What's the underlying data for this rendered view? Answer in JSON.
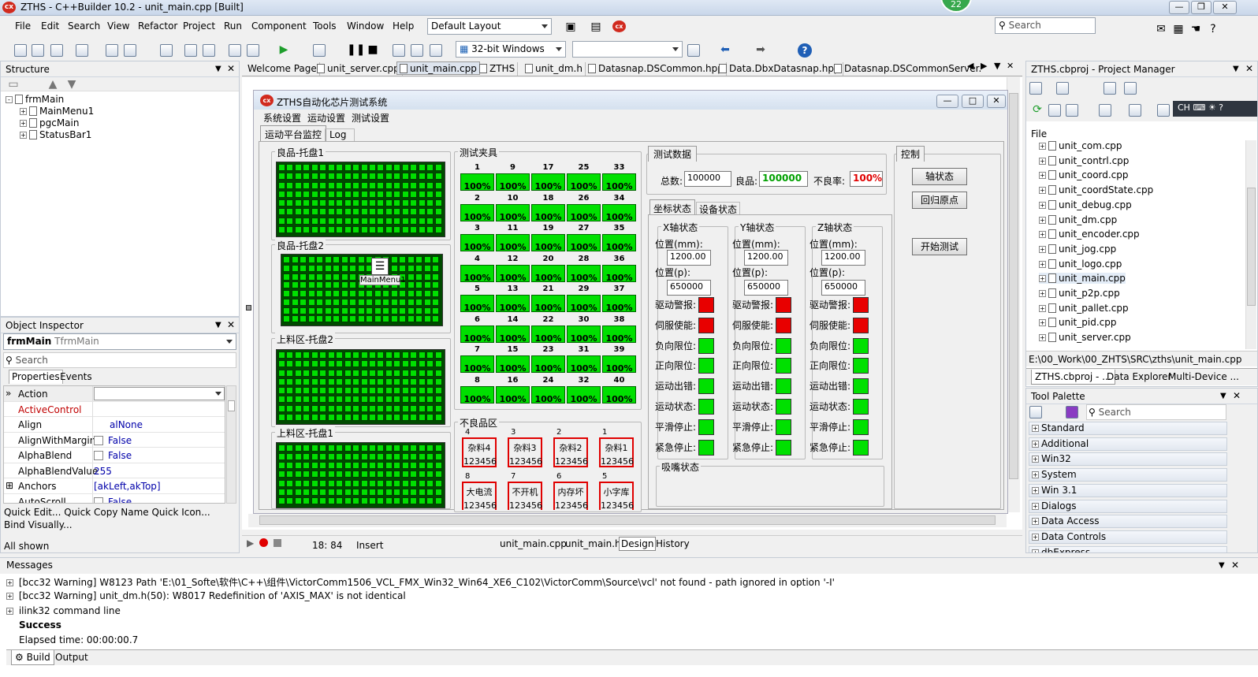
{
  "window": {
    "title": "ZTHS - C++Builder 10.2 - unit_main.cpp [Built]",
    "badge": "22",
    "app_icon": "cx"
  },
  "menu": [
    "File",
    "Edit",
    "Search",
    "View",
    "Refactor",
    "Project",
    "Run",
    "Component",
    "Tools",
    "Window",
    "Help"
  ],
  "layout_combo": "Default Layout",
  "top_search": {
    "placeholder": "Search"
  },
  "platform_combo": "32-bit Windows",
  "structure": {
    "title": "Structure",
    "root": "frmMain",
    "children": [
      "MainMenu1",
      "pgcMain",
      "StatusBar1"
    ]
  },
  "object_inspector": {
    "title": "Object Inspector",
    "object": "frmMain",
    "class": "TfrmMain",
    "search": "Search",
    "tabs": [
      "Properties",
      "Events"
    ],
    "rows": [
      {
        "name": "Action",
        "value": ""
      },
      {
        "name": "ActiveControl",
        "value": ""
      },
      {
        "name": "Align",
        "value": "alNone"
      },
      {
        "name": "AlignWithMargins",
        "value": "False"
      },
      {
        "name": "AlphaBlend",
        "value": "False"
      },
      {
        "name": "AlphaBlendValue",
        "value": "255"
      },
      {
        "name": "Anchors",
        "value": "[akLeft,akTop]"
      },
      {
        "name": "AutoScroll",
        "value": "False"
      }
    ],
    "quick_line1": "Quick Edit...  Quick Copy Name  Quick Icon...",
    "quick_line2": "Bind Visually...",
    "status": "All shown"
  },
  "editor_tabs": [
    "Welcome Page",
    "unit_server.cpp",
    "unit_main.cpp",
    "ZTHS",
    "unit_dm.h",
    "Datasnap.DSCommon.hpp",
    "Data.DbxDatasnap.hpp",
    "Datasnap.DSCommonServer."
  ],
  "designer": {
    "form_title": "ZTHS自动化芯片测试系统",
    "form_icon": "cx",
    "menus": [
      "系统设置",
      "运动设置",
      "测试设置"
    ],
    "tabs": [
      "运动平台监控",
      "Log"
    ],
    "trays": [
      "良品-托盘1",
      "良品-托盘2",
      "上料区-托盘2",
      "上料区-托盘1"
    ],
    "component_label": "MainMenu1",
    "fixture_title": "测试夹具",
    "fixture_pct": "100%",
    "fixture_cols": [
      [
        1,
        2,
        3,
        4,
        5,
        6,
        7,
        8
      ],
      [
        9,
        10,
        11,
        12,
        13,
        14,
        15,
        16
      ],
      [
        17,
        18,
        19,
        20,
        21,
        22,
        23,
        24
      ],
      [
        25,
        26,
        27,
        28,
        29,
        30,
        31,
        32
      ],
      [
        33,
        34,
        35,
        36,
        37,
        38,
        39,
        40
      ]
    ],
    "reject_title": "不良品区",
    "rejects_top": [
      {
        "n": "4",
        "l": "杂料4"
      },
      {
        "n": "3",
        "l": "杂料3"
      },
      {
        "n": "2",
        "l": "杂料2"
      },
      {
        "n": "1",
        "l": "杂料1"
      }
    ],
    "rejects_bottom": [
      {
        "n": "8",
        "l": "大电流"
      },
      {
        "n": "7",
        "l": "不开机"
      },
      {
        "n": "6",
        "l": "内存坏"
      },
      {
        "n": "5",
        "l": "小字库"
      }
    ],
    "reject_value": "123456",
    "test_data": {
      "title": "测试数据",
      "total_label": "总数:",
      "total": "100000",
      "good_label": "良品:",
      "good": "100000",
      "bad_label": "不良率:",
      "bad": "100%"
    },
    "status_tabs": [
      "坐标状态",
      "设备状态"
    ],
    "axes": [
      {
        "title": "X轴状态",
        "pos_mm_label": "位置(mm):",
        "pos_mm": "1200.00",
        "pos_p_label": "位置(p):",
        "pos_p": "650000"
      },
      {
        "title": "Y轴状态",
        "pos_mm_label": "位置(mm):",
        "pos_mm": "1200.00",
        "pos_p_label": "位置(p):",
        "pos_p": "650000"
      },
      {
        "title": "Z轴状态",
        "pos_mm_label": "位置(mm):",
        "pos_mm": "1200.00",
        "pos_p_label": "位置(p):",
        "pos_p": "650000"
      }
    ],
    "axis_signals": [
      {
        "label": "驱动警报:",
        "state": "red"
      },
      {
        "label": "伺服使能:",
        "state": "red"
      },
      {
        "label": "负向限位:",
        "state": "green"
      },
      {
        "label": "正向限位:",
        "state": "green"
      },
      {
        "label": "运动出错:",
        "state": "green"
      },
      {
        "label": "运动状态:",
        "state": "green"
      },
      {
        "label": "平滑停止:",
        "state": "green"
      },
      {
        "label": "紧急停止:",
        "state": "green"
      }
    ],
    "suction_title": "吸嘴状态",
    "control": {
      "title": "控制",
      "buttons": [
        "轴状态",
        "回归原点",
        "开始测试"
      ]
    }
  },
  "editor_status": {
    "pos": "18: 84",
    "mode": "Insert",
    "tabs": [
      "unit_main.cpp",
      "unit_main.h",
      "Design",
      "History"
    ]
  },
  "project_manager": {
    "title": "ZTHS.cbproj - Project Manager",
    "col": "File",
    "ime": "CH",
    "files": [
      "unit_com.cpp",
      "unit_contrl.cpp",
      "unit_coord.cpp",
      "unit_coordState.cpp",
      "unit_debug.cpp",
      "unit_dm.cpp",
      "unit_encoder.cpp",
      "unit_jog.cpp",
      "unit_logo.cpp",
      "unit_main.cpp",
      "unit_p2p.cpp",
      "unit_pallet.cpp",
      "unit_pid.cpp",
      "unit_server.cpp"
    ],
    "path": "E:\\00_Work\\00_ZHTS\\SRC\\zths\\unit_main.cpp",
    "tabs": [
      "ZTHS.cbproj - ...",
      "Data Explorer",
      "Multi-Device ..."
    ]
  },
  "tool_palette": {
    "title": "Tool Palette",
    "search": "Search",
    "categories": [
      "Standard",
      "Additional",
      "Win32",
      "System",
      "Win 3.1",
      "Dialogs",
      "Data Access",
      "Data Controls",
      "dbExpress"
    ]
  },
  "messages": {
    "title": "Messages",
    "lines": [
      "[bcc32 Warning] W8123 Path 'E:\\01_Softe\\软件\\C++\\组件\\VictorComm1506_VCL_FMX_Win32_Win64_XE6_C102\\VictorComm\\Source\\vcl' not found - path ignored in option '-I'",
      "[bcc32 Warning] unit_dm.h(50): W8017 Redefinition of 'AXIS_MAX' is not identical",
      "ilink32 command line",
      "Success",
      "Elapsed time: 00:00:00.7"
    ],
    "tabs": [
      "Build",
      "Output"
    ]
  }
}
